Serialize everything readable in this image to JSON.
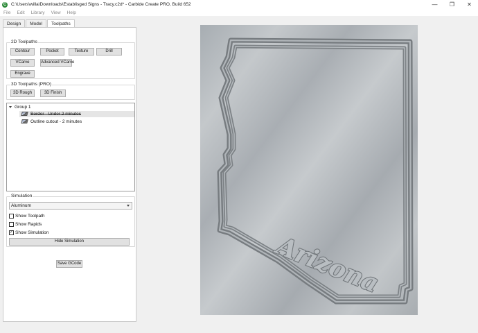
{
  "window": {
    "title": "C:\\Users\\willa\\Downloads\\Establisged Signs - Tracy.c2d* - Carbide Create PRO, Build 652",
    "controls": [
      "—",
      "❐",
      "✕"
    ]
  },
  "menu": [
    "File",
    "Edit",
    "Library",
    "View",
    "Help"
  ],
  "tabs": [
    "Design",
    "Model",
    "Toolpaths"
  ],
  "toolpaths2d": {
    "title": "2D Toolpaths",
    "buttons": [
      "Contour",
      "Pocket",
      "Texture",
      "Drill",
      "VCarve",
      "Advanced VCarve",
      "Engrave"
    ]
  },
  "toolpaths3d": {
    "title": "3D Toolpaths (PRO)",
    "buttons": [
      "3D Rough",
      "3D Finish"
    ]
  },
  "tree": {
    "group": "Group 1",
    "items": [
      "Border - Under 2 minutes",
      "Outline cutout - 2 minutes"
    ]
  },
  "simulation": {
    "title": "Simulation",
    "material": "Aluminum",
    "show_toolpath": "Show Toolpath",
    "show_toolpath_checked": false,
    "show_rapids": "Show Rapids",
    "show_rapids_checked": false,
    "show_simulation": "Show Simulation",
    "show_simulation_checked": true,
    "check_mark": "✓",
    "hide_button": "Hide Simulation"
  },
  "save_gcode": "Save GCode",
  "canvas": {
    "engraved_text": "Arizona",
    "material_color": "#b3b8bc",
    "groove_color": "#7e8286"
  }
}
